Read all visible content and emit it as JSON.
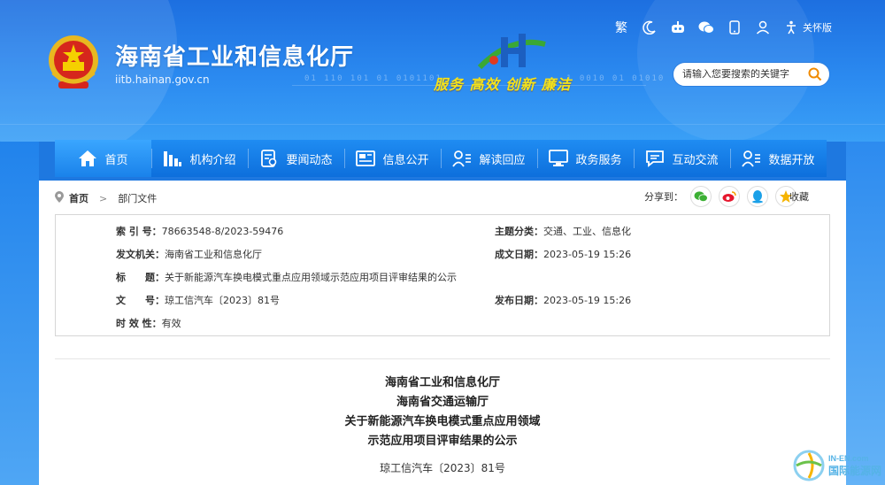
{
  "header": {
    "site_title": "海南省工业和信息化厅",
    "domain": "iitb.hainan.gov.cn",
    "slogan": "服务 高效 创新 廉洁",
    "toolbar": {
      "traditional": "繁",
      "accessibility_label": "关怀版"
    },
    "search_placeholder": "请输入您要搜索的关键字"
  },
  "nav": {
    "items": [
      {
        "label": "首页",
        "icon": "home-icon"
      },
      {
        "label": "机构介绍",
        "icon": "org-icon"
      },
      {
        "label": "要闻动态",
        "icon": "news-icon"
      },
      {
        "label": "信息公开",
        "icon": "info-icon"
      },
      {
        "label": "解读回应",
        "icon": "interpret-icon"
      },
      {
        "label": "政务服务",
        "icon": "monitor-icon"
      },
      {
        "label": "互动交流",
        "icon": "chat-icon"
      },
      {
        "label": "数据开放",
        "icon": "data-icon"
      }
    ]
  },
  "breadcrumb": {
    "home": "首页",
    "current": "部门文件"
  },
  "share": {
    "label": "分享到：",
    "favorite": "收藏"
  },
  "meta": {
    "index_key": "索 引 号：",
    "index_val": "78663548-8/2023-59476",
    "topic_key": "主题分类：",
    "topic_val": "交通、工业、信息化",
    "issuer_key": "发文机关：",
    "issuer_val": "海南省工业和信息化厅",
    "created_key": "成文日期：",
    "created_val": "2023-05-19 15:26",
    "title_key": "标　　题：",
    "title_val": "关于新能源汽车换电模式重点应用领域示范应用项目评审结果的公示",
    "docno_key": "文　　号：",
    "docno_val": "琼工信汽车〔2023〕81号",
    "published_key": "发布日期：",
    "published_val": "2023-05-19 15:26",
    "validity_key": "时 效 性：",
    "validity_val": "有效"
  },
  "article": {
    "line1": "海南省工业和信息化厅",
    "line2": "海南省交通运输厅",
    "line3": "关于新能源汽车换电模式重点应用领域",
    "line4": "示范应用项目评审结果的公示",
    "doc_no": "琼工信汽车〔2023〕81号"
  },
  "watermark": {
    "en": "IN-EN.com",
    "cn": "国际能源网"
  },
  "colors": {
    "banner": "#1d6fe0",
    "nav": "#0d6fdc",
    "slogan": "#f5e31a",
    "wechat": "#3cb034",
    "weibo": "#e6162d",
    "qq": "#1aa0e8",
    "favorite": "#f5b400"
  }
}
